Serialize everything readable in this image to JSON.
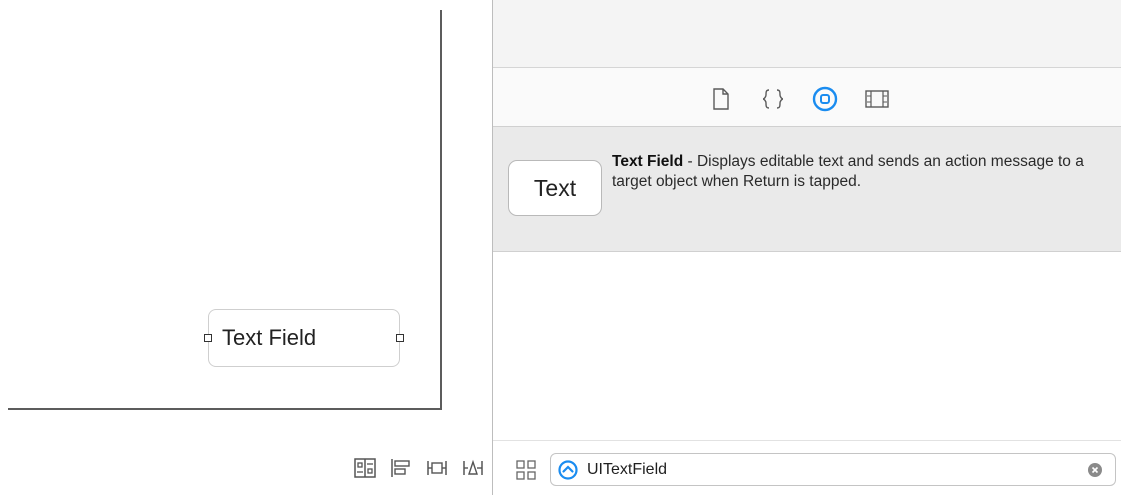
{
  "canvas": {
    "text_field_label": "Text Field"
  },
  "inspector": {
    "tabs": [
      {
        "icon": "file-icon"
      },
      {
        "icon": "code-braces-icon"
      },
      {
        "icon": "object-library-icon",
        "selected": true
      },
      {
        "icon": "media-library-icon"
      }
    ],
    "library_item": {
      "thumbnail_text": "Text",
      "title": "Text Field",
      "description": " - Displays editable text and sends an action message to a target object when Return is tapped."
    },
    "filter": {
      "value": "UITextField"
    }
  },
  "colors": {
    "accent": "#1a8cf0",
    "border": "#5c5c5c",
    "library_row_bg": "#eaeaea"
  }
}
